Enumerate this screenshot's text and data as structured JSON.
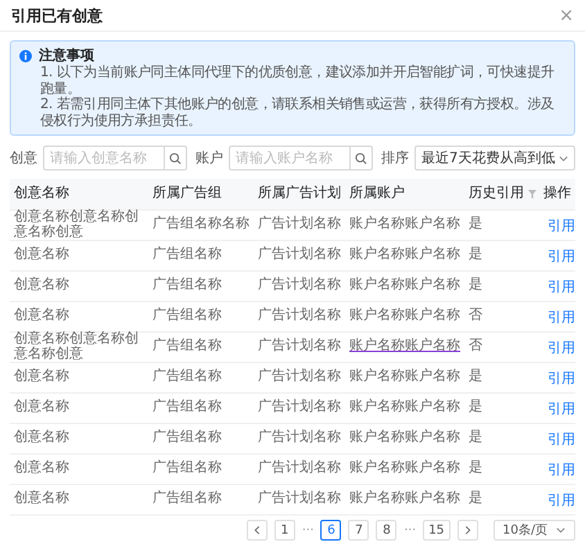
{
  "dialog": {
    "title": "引用已有创意",
    "close_label": "×"
  },
  "notice": {
    "title": "注意事项",
    "lines": [
      "1. 以下为当前账户同主体同代理下的优质创意，建议添加并开启智能扩词，可快速提升跑量。",
      "2. 若需引用同主体下其他账户的创意，请联系相关销售或运营，获得所有方授权。涉及侵权行为使用方承担责任。"
    ]
  },
  "filters": [
    {
      "kind": "search",
      "label": "创意",
      "placeholder": "请输入创意名称"
    },
    {
      "kind": "search",
      "label": "账户",
      "placeholder": "请输入账户名称"
    },
    {
      "kind": "select",
      "label": "排序",
      "value": "最近7天花费从高到低"
    }
  ],
  "table": {
    "columns": [
      "创意名称",
      "所属广告组",
      "所属广告计划",
      "所属账户",
      "历史引用",
      "操作"
    ],
    "rows": [
      {
        "name": "创意名称创意名称创意名称创意",
        "group": "广告组名称名称",
        "plan": "广告计划名称",
        "account": "账户名称账户名称",
        "history": "是",
        "action": "引用",
        "account_underlined": false
      },
      {
        "name": "创意名称",
        "group": "广告组名称",
        "plan": "广告计划名称",
        "account": "账户名称账户名称",
        "history": "是",
        "action": "引用",
        "account_underlined": false
      },
      {
        "name": "创意名称",
        "group": "广告组名称",
        "plan": "广告计划名称",
        "account": "账户名称账户名称",
        "history": "是",
        "action": "引用",
        "account_underlined": false
      },
      {
        "name": "创意名称",
        "group": "广告组名称",
        "plan": "广告计划名称",
        "account": "账户名称账户名称",
        "history": "否",
        "action": "引用",
        "account_underlined": false
      },
      {
        "name": "创意名称创意名称创意名称创意",
        "group": "广告组名称",
        "plan": "广告计划名称",
        "account": "账户名称账户名称",
        "history": "否",
        "action": "引用",
        "account_underlined": true
      },
      {
        "name": "创意名称",
        "group": "广告组名称",
        "plan": "广告计划名称",
        "account": "账户名称账户名称",
        "history": "是",
        "action": "引用",
        "account_underlined": false
      },
      {
        "name": "创意名称",
        "group": "广告组名称",
        "plan": "广告计划名称",
        "account": "账户名称账户名称",
        "history": "是",
        "action": "引用",
        "account_underlined": false
      },
      {
        "name": "创意名称",
        "group": "广告组名称",
        "plan": "广告计划名称",
        "account": "账户名称账户名称",
        "history": "是",
        "action": "引用",
        "account_underlined": false
      },
      {
        "name": "创意名称",
        "group": "广告组名称",
        "plan": "广告计划名称",
        "account": "账户名称账户名称",
        "history": "是",
        "action": "引用",
        "account_underlined": false
      },
      {
        "name": "创意名称",
        "group": "广告组名称",
        "plan": "广告计划名称",
        "account": "账户名称账户名称",
        "history": "是",
        "action": "引用",
        "account_underlined": false
      }
    ]
  },
  "pagination": {
    "pages": [
      {
        "kind": "page",
        "label": "1",
        "selected": false
      },
      {
        "kind": "ellipsis",
        "label": "···",
        "selected": false
      },
      {
        "kind": "page",
        "label": "6",
        "selected": true
      },
      {
        "kind": "page",
        "label": "7",
        "selected": false
      },
      {
        "kind": "page",
        "label": "8",
        "selected": false
      },
      {
        "kind": "ellipsis",
        "label": "···",
        "selected": false
      },
      {
        "kind": "page",
        "label": "15",
        "selected": false
      }
    ],
    "page_size": "10条/页"
  }
}
